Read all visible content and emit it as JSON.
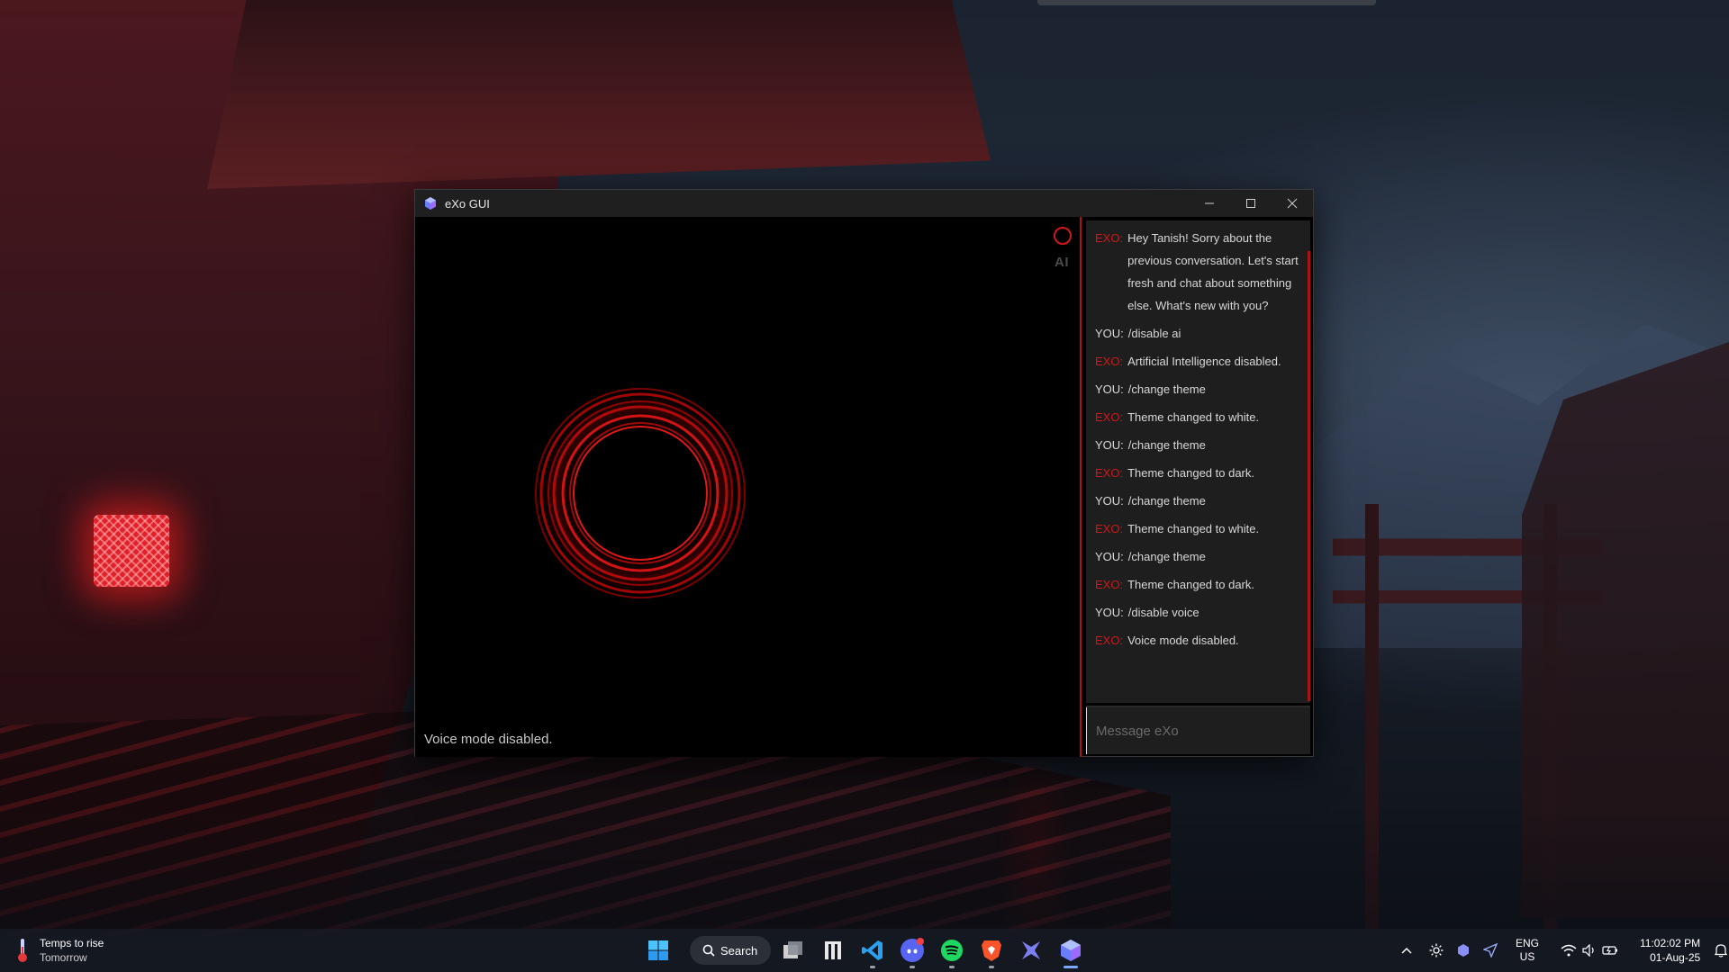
{
  "window": {
    "title": "eXo GUI",
    "minimize_icon": "minimize-icon",
    "maximize_icon": "maximize-icon",
    "close_icon": "close-icon"
  },
  "visualizer": {
    "ai_label": "AI",
    "status_text": "Voice mode disabled.",
    "accent_color": "#d01818"
  },
  "chat": {
    "messages": [
      {
        "who": "EXO:",
        "text": "Hey Tanish! Sorry about the previous conversation. Let's start fresh and chat about something else. What's new with you?"
      },
      {
        "who": "YOU:",
        "text": "/disable ai"
      },
      {
        "who": "EXO:",
        "text": "Artificial Intelligence disabled."
      },
      {
        "who": "YOU:",
        "text": "/change theme"
      },
      {
        "who": "EXO:",
        "text": "Theme changed to white."
      },
      {
        "who": "YOU:",
        "text": "/change theme"
      },
      {
        "who": "EXO:",
        "text": "Theme changed to dark."
      },
      {
        "who": "YOU:",
        "text": "/change theme"
      },
      {
        "who": "EXO:",
        "text": "Theme changed to white."
      },
      {
        "who": "YOU:",
        "text": "/change theme"
      },
      {
        "who": "EXO:",
        "text": "Theme changed to dark."
      },
      {
        "who": "YOU:",
        "text": "/disable voice"
      },
      {
        "who": "EXO:",
        "text": "Voice mode disabled."
      }
    ],
    "input_placeholder": "Message eXo"
  },
  "taskbar": {
    "widget_title": "Temps to rise",
    "widget_subtitle": "Tomorrow",
    "search_label": "Search",
    "apps": [
      "windows-start-icon",
      "task-view-icon",
      "app-icon",
      "vscode-icon",
      "discord-icon",
      "spotify-icon",
      "brave-icon",
      "app-icon",
      "exo-icon"
    ],
    "tray": {
      "lang_line1": "ENG",
      "lang_line2": "US",
      "time": "11:02:02 PM",
      "date": "01-Aug-25"
    }
  }
}
